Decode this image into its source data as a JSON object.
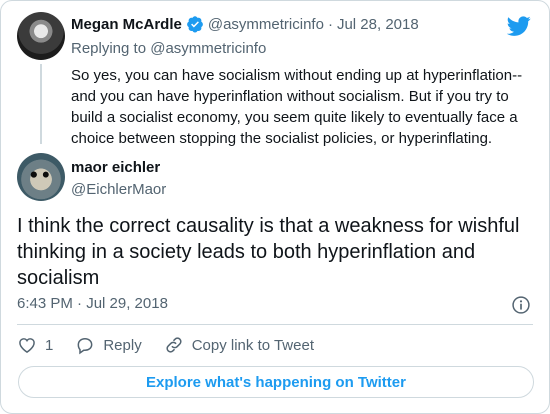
{
  "parent_tweet": {
    "author_name": "Megan McArdle",
    "author_handle": "@asymmetricinfo",
    "separator": "·",
    "date": "Jul 28, 2018",
    "replying_to": "Replying to @asymmetricinfo",
    "text": "So yes, you can have socialism without ending up at hyperinflation-- and you can have hyperinflation without socialism. But if you try to build a socialist economy, you seem quite likely to eventually face a choice between stopping the socialist policies, or hyperinflating."
  },
  "tweet": {
    "author_name": "maor eichler",
    "author_handle": "@EichlerMaor",
    "text": "I think the correct causality is that a weakness for wishful thinking in a society leads to both hyperinflation and socialism",
    "timestamp": "6:43 PM · Jul 29, 2018"
  },
  "actions": {
    "like_count": "1",
    "reply_label": "Reply",
    "copy_link_label": "Copy link to Tweet"
  },
  "explore_label": "Explore what's happening on Twitter",
  "colors": {
    "accent": "#1d9bf0",
    "secondary_text": "#536471",
    "border": "#cfd9de"
  }
}
